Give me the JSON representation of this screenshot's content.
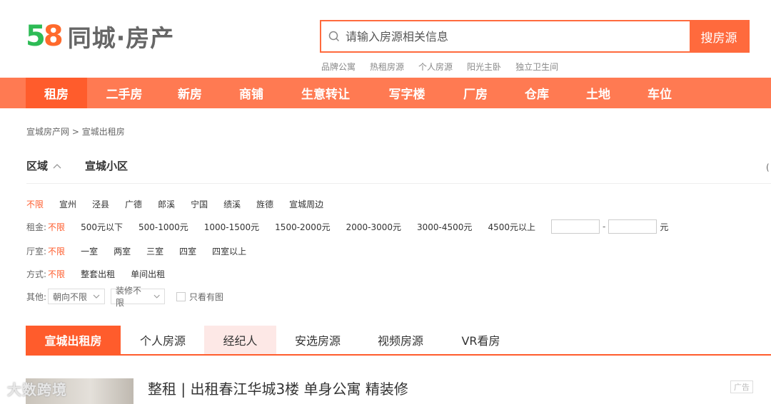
{
  "header": {
    "logo_digit_5": "5",
    "logo_digit_8": "8",
    "logo_text": "同城·房产",
    "search_placeholder": "请输入房源相关信息",
    "search_button": "搜房源",
    "hot_links": [
      "品牌公寓",
      "热租房源",
      "个人房源",
      "阳光主卧",
      "独立卫生间"
    ]
  },
  "nav": {
    "items": [
      "租房",
      "二手房",
      "新房",
      "商铺",
      "生意转让",
      "写字楼",
      "厂房",
      "仓库",
      "土地",
      "车位"
    ],
    "active_index": 0
  },
  "breadcrumb": {
    "home": "宣城房产网",
    "separator": ">",
    "current": "宣城出租房"
  },
  "filters": {
    "tab_area": "区域",
    "tab_community": "宣城小区",
    "cut_char": "(",
    "area_options": [
      "不限",
      "宣州",
      "泾县",
      "广德",
      "郎溪",
      "宁国",
      "绩溪",
      "旌德",
      "宣城周边"
    ],
    "rent_label": "租金:",
    "rent_options": [
      "不限",
      "500元以下",
      "500-1000元",
      "1000-1500元",
      "1500-2000元",
      "2000-3000元",
      "3000-4500元",
      "4500元以上"
    ],
    "rent_range_dash": "-",
    "rent_unit": "元",
    "room_label": "厅室:",
    "room_options": [
      "不限",
      "一室",
      "两室",
      "三室",
      "四室",
      "四室以上"
    ],
    "mode_label": "方式:",
    "mode_options": [
      "不限",
      "整套出租",
      "单间出租"
    ],
    "other_label": "其他:",
    "orientation": "朝向不限",
    "decoration": "装修不限",
    "with_photos": "只看有图"
  },
  "list_tabs": {
    "items": [
      "宣城出租房",
      "个人房源",
      "经纪人",
      "安选房源",
      "视频房源",
      "VR看房"
    ],
    "active_index": 0,
    "highlight_index": 2
  },
  "listing": {
    "watermark": "大数跨境",
    "title": "整租 | 出租春江华城3楼 单身公寓 精装修",
    "ad_badge": "广告"
  },
  "colors": {
    "brand": "#ff5c2c",
    "nav_bg": "#ff7a52",
    "search_border": "#ff6a3d"
  }
}
